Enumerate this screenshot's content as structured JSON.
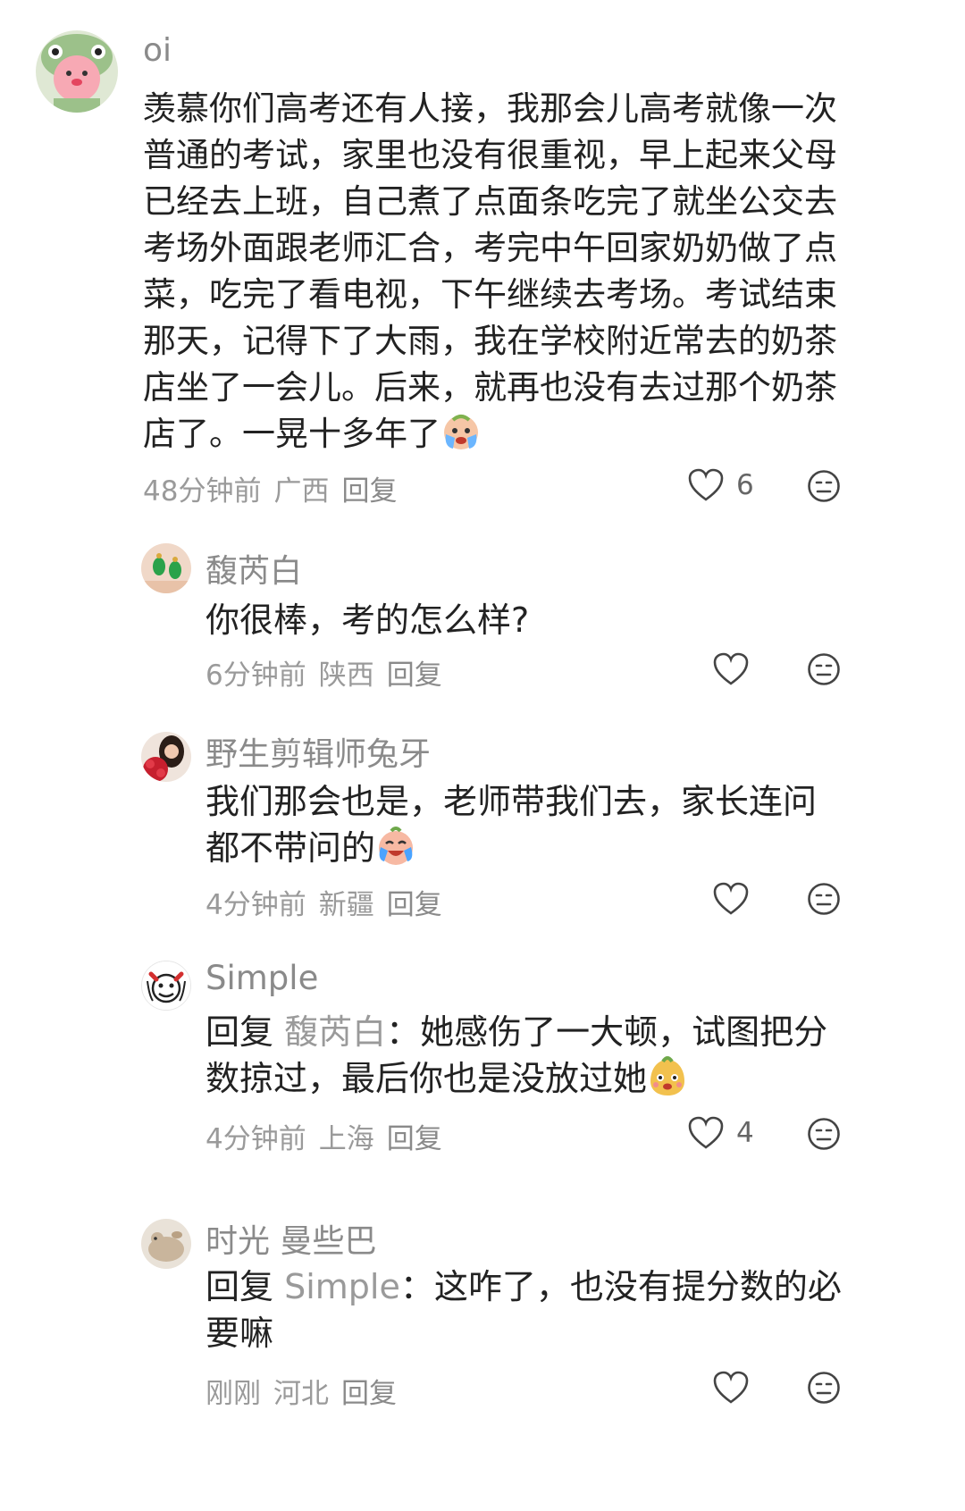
{
  "comments": [
    {
      "username": "oi",
      "text": "羡慕你们高考还有人接，我那会儿高考就像一次普通的考试，家里也没有很重视，早上起来父母已经去上班，自己煮了点面条吃完了就坐公交去考场外面跟老师汇合，考完中午回家奶奶做了点菜，吃完了看电视，下午继续去考场。考试结束那天，记得下了大雨，我在学校附近常去的奶茶店坐了一会儿。后来，就再也没有去过那个奶茶店了。一晃十多年了",
      "time": "48分钟前",
      "location": "广西",
      "reply_label": "回复",
      "likes": "6"
    },
    {
      "username": "馥芮白",
      "text": "你很棒，考的怎么样?",
      "time": "6分钟前",
      "location": "陕西",
      "reply_label": "回复",
      "likes": ""
    },
    {
      "username": "野生剪辑师兔牙",
      "text": "我们那会也是，老师带我们去，家长连问都不带问的",
      "time": "4分钟前",
      "location": "新疆",
      "reply_label": "回复",
      "likes": ""
    },
    {
      "username": "Simple",
      "reply_prefix": "回复",
      "reply_target": "馥芮白",
      "text": "她感伤了一大顿，试图把分数掠过，最后你也是没放过她",
      "time": "4分钟前",
      "location": "上海",
      "reply_label": "回复",
      "likes": "4"
    },
    {
      "username": "时光 曼些巴",
      "reply_prefix": "回复",
      "reply_target": "Simple",
      "text": "这咋了，也没有提分数的必要嘛",
      "time": "刚刚",
      "location": "河北",
      "reply_label": "回复",
      "likes": ""
    }
  ],
  "punct": {
    "colon": "："
  },
  "icons": {
    "like": "heart-outline-icon",
    "dislike": "neutral-face-icon",
    "emoji_1": "crying-face-emoji",
    "emoji_2": "laughing-tears-emoji",
    "emoji_3": "smiling-mascot-emoji"
  }
}
